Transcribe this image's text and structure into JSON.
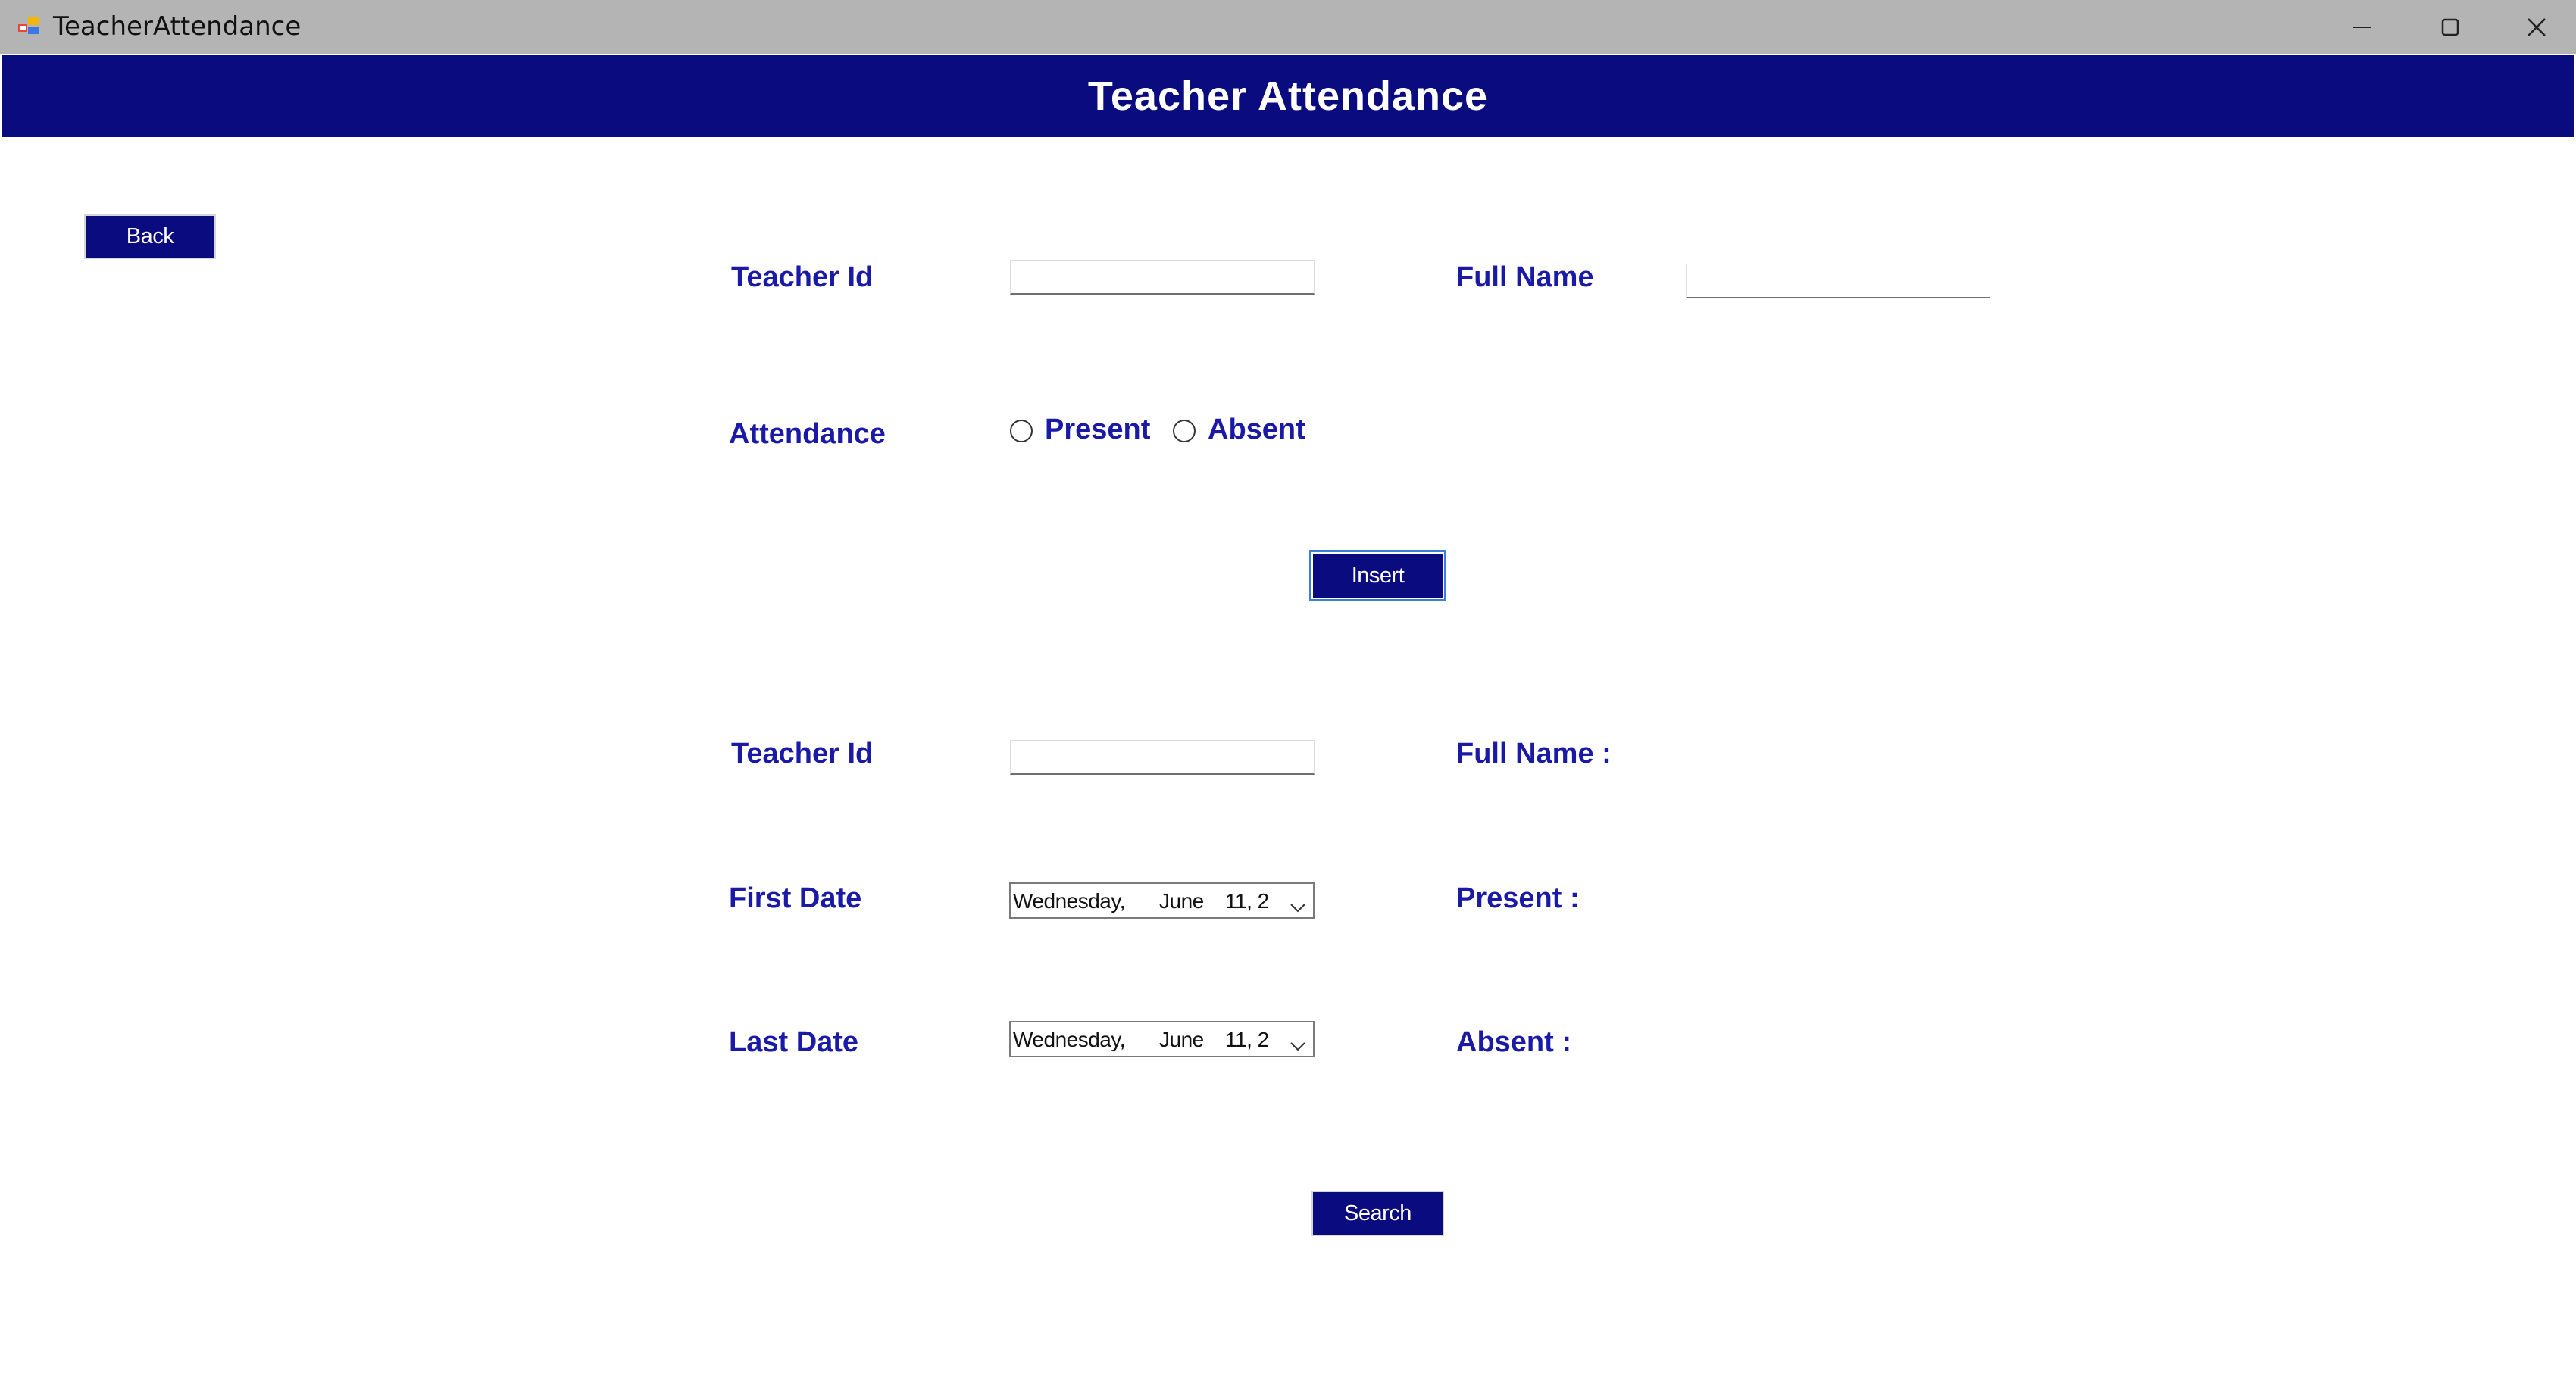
{
  "window": {
    "title": "TeacherAttendance"
  },
  "header": {
    "title": "Teacher Attendance",
    "background": "#0b0b80"
  },
  "buttons": {
    "back": "Back",
    "insert": "Insert",
    "search": "Search"
  },
  "insert_form": {
    "teacher_id_label": "Teacher Id",
    "teacher_id_value": "",
    "full_name_label": "Full Name",
    "full_name_value": "",
    "attendance_label": "Attendance",
    "present_option": "Present",
    "absent_option": "Absent",
    "selected": null
  },
  "search_form": {
    "teacher_id_label": "Teacher Id",
    "teacher_id_value": "",
    "first_date_label": "First Date",
    "first_date": {
      "weekday": "Wednesday,",
      "month": "June",
      "day": "11, 2"
    },
    "last_date_label": "Last Date",
    "last_date": {
      "weekday": "Wednesday,",
      "month": "June",
      "day": "11, 2"
    },
    "full_name_result_label": "Full Name :",
    "present_result_label": "Present :",
    "absent_result_label": "Absent :"
  },
  "icons": {
    "app": "app-icon",
    "minimize": "minimize-icon",
    "maximize": "maximize-icon",
    "close": "close-icon",
    "dropdown": "chevron-down-icon"
  },
  "colors": {
    "label_text": "#1a1aa6",
    "button_bg": "#0b0b80",
    "titlebar_bg": "#b4b4b4"
  }
}
